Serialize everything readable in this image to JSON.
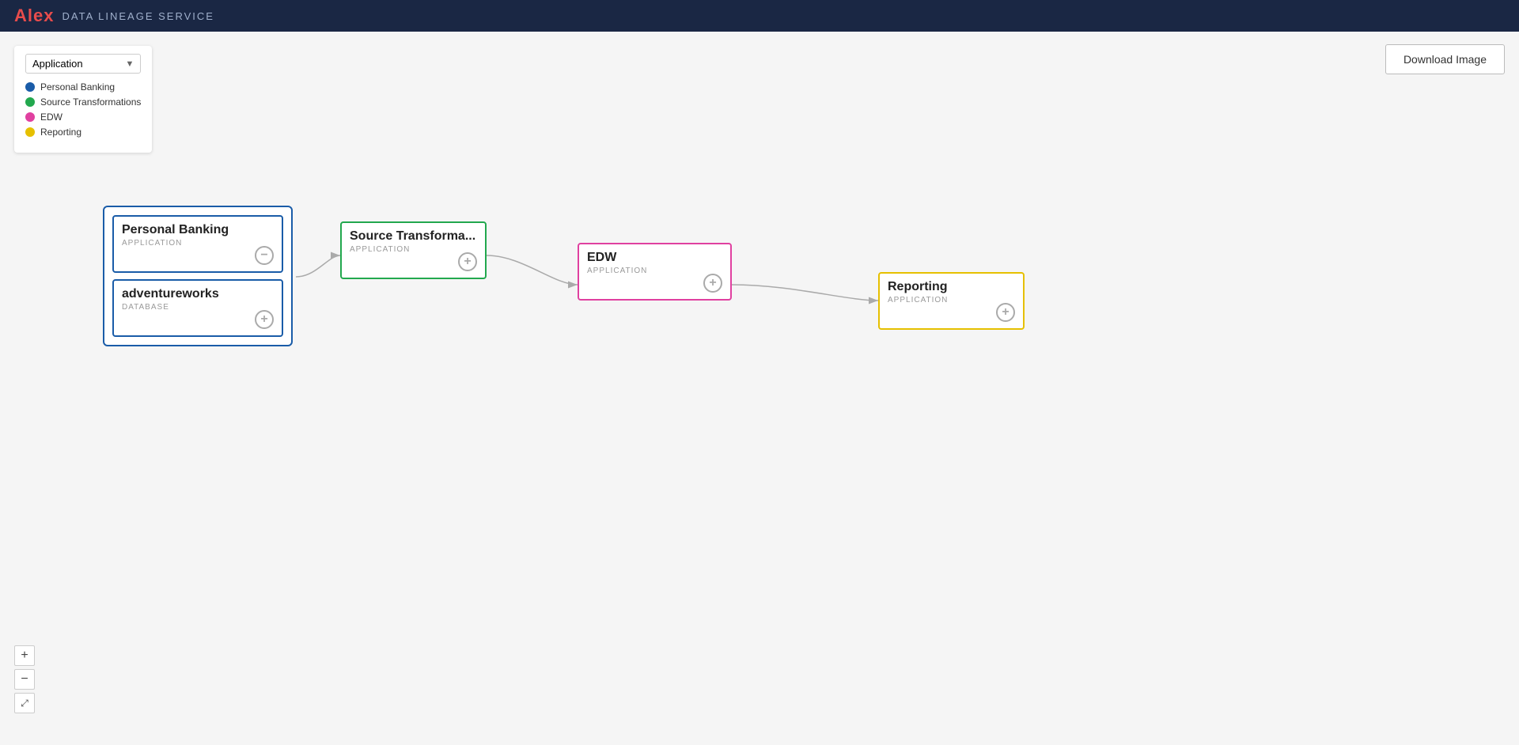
{
  "navbar": {
    "logo_text": "Alex",
    "logo_accent": "x",
    "title": "DATA LINEAGE SERVICE"
  },
  "filter": {
    "label": "Application",
    "legend": [
      {
        "name": "Personal Banking",
        "color": "#1a5ca8"
      },
      {
        "name": "Source Transformations",
        "color": "#22a84e"
      },
      {
        "name": "EDW",
        "color": "#e040a0"
      },
      {
        "name": "Reporting",
        "color": "#e6c000"
      }
    ]
  },
  "download_btn": "Download Image",
  "zoom": {
    "plus": "+",
    "minus": "−",
    "fit": "⤢"
  },
  "nodes": {
    "personal_banking": {
      "title": "Personal Banking",
      "subtitle": "APPLICATION"
    },
    "adventureworks": {
      "title": "adventureworks",
      "subtitle": "DATABASE"
    },
    "source_transformations": {
      "title": "Source Transforma...",
      "subtitle": "APPLICATION"
    },
    "edw": {
      "title": "EDW",
      "subtitle": "APPLICATION"
    },
    "reporting": {
      "title": "Reporting",
      "subtitle": "APPLICATION"
    }
  }
}
